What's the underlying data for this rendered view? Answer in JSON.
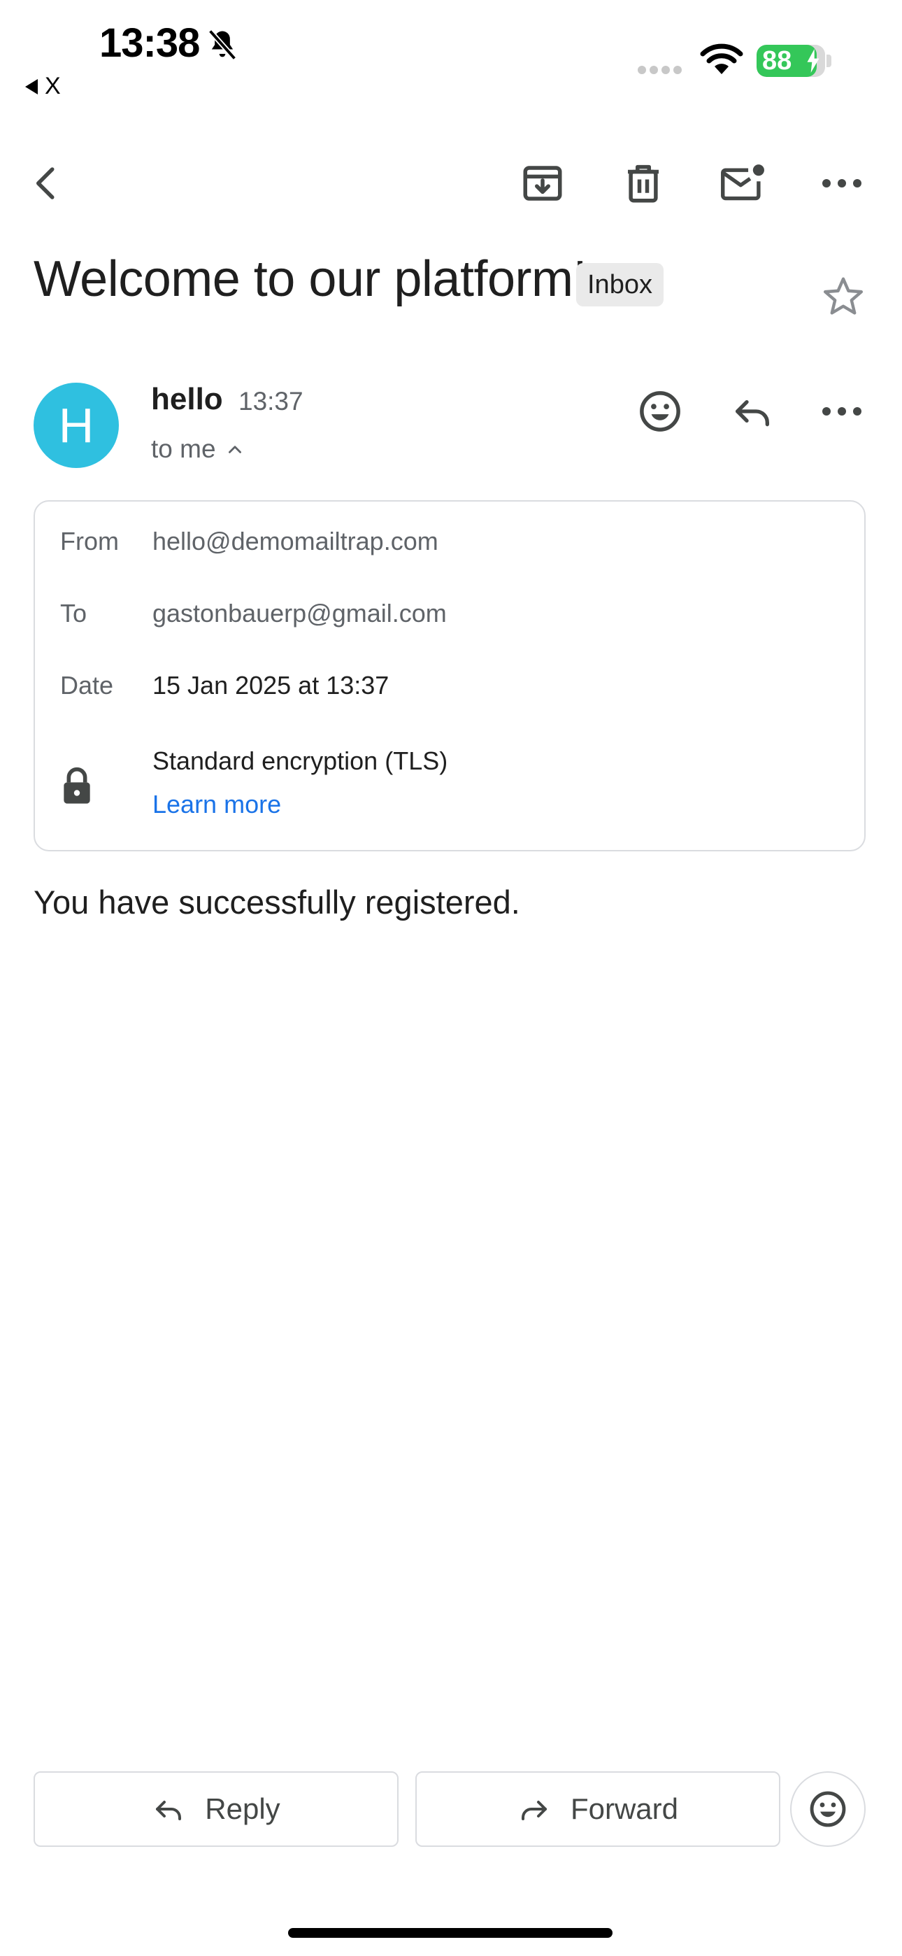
{
  "status_bar": {
    "time": "13:38",
    "back_label": "X",
    "battery": "88",
    "battery_level": 0.88
  },
  "email": {
    "subject": "Welcome to our platform!",
    "label_chip": "Inbox",
    "sender_initial": "H",
    "sender_name": "hello",
    "time": "13:37",
    "recipient_summary": "to me",
    "details": {
      "from_label": "From",
      "from_value": "hello@demomailtrap.com",
      "to_label": "To",
      "to_value": "gastonbauerp@gmail.com",
      "date_label": "Date",
      "date_value": "15 Jan 2025 at 13:37",
      "encryption": "Standard encryption (TLS)",
      "learn_more": "Learn more"
    },
    "body": "You have successfully registered."
  },
  "actions": {
    "reply": "Reply",
    "forward": "Forward"
  },
  "colors": {
    "avatar": "#2fc0e0",
    "link": "#1a73e8",
    "battery": "#34c759",
    "chip_bg": "#eaeaea"
  }
}
